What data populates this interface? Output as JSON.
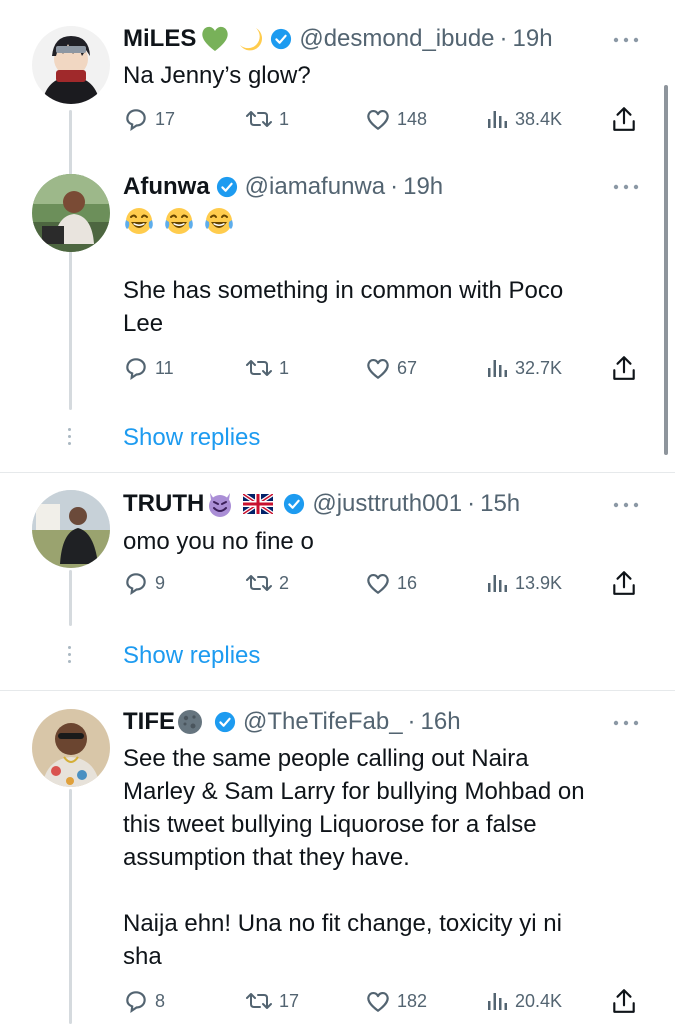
{
  "tweets": [
    {
      "name": "MiLES",
      "name_emojis": [
        "green-heart",
        "crescent-moon"
      ],
      "handle": "@desmond_ibude",
      "time": "19h",
      "text": [
        "Na Jenny’s glow?"
      ],
      "replies": "17",
      "reposts": "1",
      "likes": "148",
      "views": "38.4K"
    },
    {
      "name": "Afunwa",
      "name_emojis": [],
      "handle": "@iamafunwa",
      "time": "19h",
      "emoji_line": [
        "face-with-tears-of-joy",
        "face-with-tears-of-joy",
        "face-with-tears-of-joy"
      ],
      "text": [
        "She has something in common with Poco",
        "Lee"
      ],
      "replies": "11",
      "reposts": "1",
      "likes": "67",
      "views": "32.7K"
    },
    {
      "name": "TRUTH",
      "name_emojis": [
        "smiling-face-with-horns",
        "union-jack-flag"
      ],
      "handle": "@justtruth001",
      "time": "15h",
      "text": [
        "omo you no fine o"
      ],
      "replies": "9",
      "reposts": "2",
      "likes": "16",
      "views": "13.9K"
    },
    {
      "name": "TIFE",
      "name_emojis": [
        "new-moon-face"
      ],
      "handle": "@TheTifeFab_",
      "time": "16h",
      "text": [
        "See the same people calling out Naira",
        "Marley & Sam Larry for bullying Mohbad on",
        "this tweet bullying Liquorose for a false",
        "assumption that they have.",
        "",
        "Naija ehn! Una no fit change, toxicity yi ni",
        "sha"
      ],
      "replies": "8",
      "reposts": "17",
      "likes": "182",
      "views": "20.4K"
    }
  ],
  "show_replies_label": "Show replies",
  "separator": "·",
  "colors": {
    "accent": "#1d9bf0",
    "muted": "#536471",
    "text": "#0f1419",
    "divider": "#e6e9eb"
  }
}
